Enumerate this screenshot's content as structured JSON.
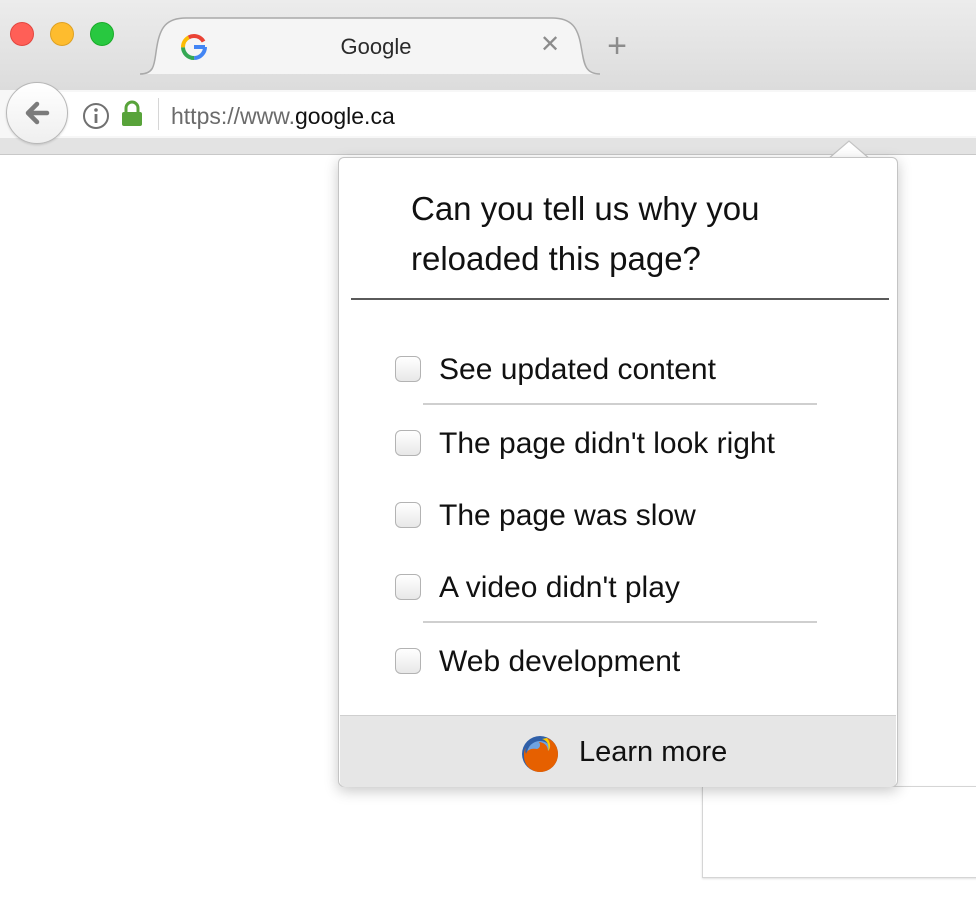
{
  "browser": {
    "tab": {
      "title": "Google",
      "close_glyph": "✕",
      "favicon": "google-icon"
    },
    "new_tab_glyph": "+",
    "url": {
      "prefix": "https://www.",
      "domain": "google.ca"
    }
  },
  "popup": {
    "question": "Can you tell us why you reloaded this page?",
    "options": [
      {
        "label": "See updated content",
        "checked": false
      },
      {
        "label": "The page didn't look right",
        "checked": false
      },
      {
        "label": "The page was slow",
        "checked": false
      },
      {
        "label": "A video didn't play",
        "checked": false
      },
      {
        "label": "Web development",
        "checked": false
      }
    ],
    "footer": {
      "label": "Learn more",
      "icon": "firefox-icon"
    }
  },
  "colors": {
    "lock_green": "#58a33a",
    "close_red": "#ff5f57",
    "minimize_yellow": "#febc2e",
    "zoom_green": "#28c840"
  }
}
